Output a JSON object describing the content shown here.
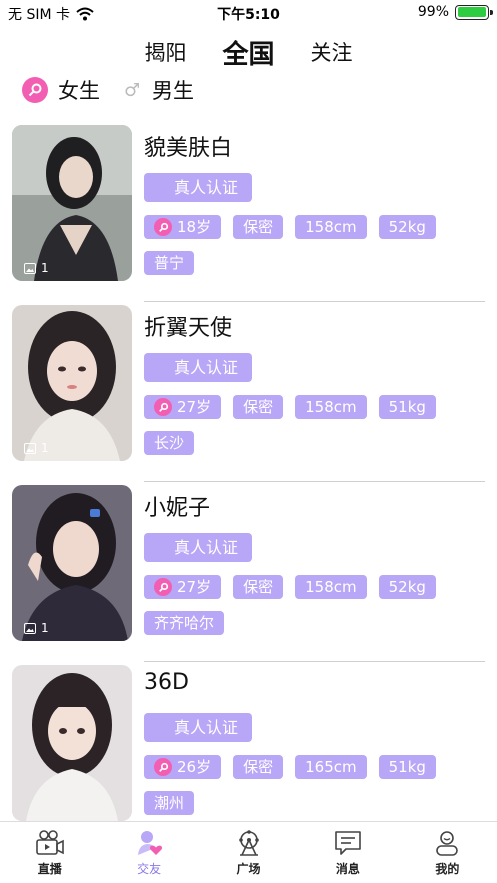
{
  "status_bar": {
    "carrier": "无 SIM 卡",
    "time": "下午5:10",
    "battery": "99%",
    "battery_level": 0.99
  },
  "top_tabs": [
    {
      "label": "揭阳",
      "active": false
    },
    {
      "label": "全国",
      "active": true
    },
    {
      "label": "关注",
      "active": false
    }
  ],
  "gender_filter": {
    "female_label": "女生",
    "male_label": "男生",
    "selected": "female"
  },
  "users": [
    {
      "name": "貌美肤白",
      "verify": "真人认证",
      "age": "18岁",
      "secret": "保密",
      "height": "158cm",
      "weight": "52kg",
      "city": "普宁",
      "photo_count": "1"
    },
    {
      "name": "折翼天使",
      "verify": "真人认证",
      "age": "27岁",
      "secret": "保密",
      "height": "158cm",
      "weight": "51kg",
      "city": "长沙",
      "photo_count": "1"
    },
    {
      "name": "小妮子",
      "verify": "真人认证",
      "age": "27岁",
      "secret": "保密",
      "height": "158cm",
      "weight": "52kg",
      "city": "齐齐哈尔",
      "photo_count": "1"
    },
    {
      "name": "36D",
      "verify": "真人认证",
      "age": "26岁",
      "secret": "保密",
      "height": "165cm",
      "weight": "51kg",
      "city": "潮州",
      "photo_count": ""
    }
  ],
  "bottom_nav": [
    {
      "label": "直播",
      "icon": "live-camera-icon",
      "active": false
    },
    {
      "label": "交友",
      "icon": "dating-heart-icon",
      "active": true
    },
    {
      "label": "广场",
      "icon": "ferris-wheel-icon",
      "active": false
    },
    {
      "label": "消息",
      "icon": "message-bubble-icon",
      "active": false
    },
    {
      "label": "我的",
      "icon": "profile-icon",
      "active": false
    }
  ],
  "colors": {
    "tag_bg": "#b8a6f6",
    "female_pink": "#f25fb2",
    "active_nav": "#8a78e8"
  }
}
